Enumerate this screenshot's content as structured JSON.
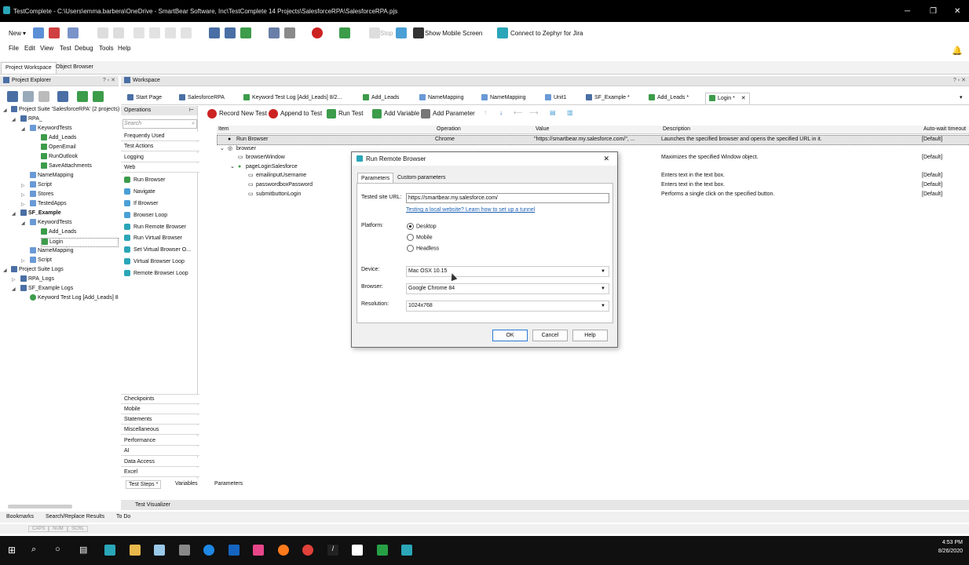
{
  "window": {
    "title": "TestComplete - C:\\Users\\emma.barbera\\OneDrive - SmartBear Software, Inc\\TestComplete 14 Projects\\SalesforceRPA\\SalesforceRPA.pjs"
  },
  "toolbar": {
    "new_label": "New",
    "stop_label": "Stop",
    "show_mobile_label": "Show Mobile Screen",
    "zephyr_label": "Connect to  Zephyr for Jira"
  },
  "menu": [
    "File",
    "Edit",
    "View",
    "Test",
    "Debug",
    "Tools",
    "Help"
  ],
  "top_tabs": [
    "Project Workspace",
    "Object Browser"
  ],
  "panels": {
    "project_explorer": "Project Explorer",
    "workspace": "Workspace",
    "operations": "Operations"
  },
  "tree": [
    "Project Suite 'SalesforceRPA' (2 projects)",
    "RPA_",
    "KeywordTests",
    "Add_Leads",
    "OpenEmail",
    "RunOutlook",
    "SaveAttachments",
    "NameMapping",
    "Script",
    "Stores",
    "TestedApps",
    "SF_Example",
    "KeywordTests",
    "Add_Leads",
    "Login",
    "NameMapping",
    "Script",
    "Project Suite Logs",
    "RPA_Logs",
    "SF_Example Logs",
    "Keyword Test Log [Add_Leads] 8"
  ],
  "ops": {
    "search_placeholder": "Search",
    "top_categories": [
      "Frequently Used",
      "Test Actions",
      "Logging",
      "Web"
    ],
    "web_items": [
      "Run Browser",
      "Navigate",
      "If Browser",
      "Browser Loop",
      "Run Remote Browser",
      "Run Virtual Browser",
      "Set Virtual Browser O...",
      "Virtual Browser Loop",
      "Remote Browser Loop"
    ],
    "bottom_categories": [
      "Checkpoints",
      "Mobile",
      "Statements",
      "Miscellaneous",
      "Performance",
      "AI",
      "Data Access",
      "Excel"
    ]
  },
  "ws_tabs": [
    "Start Page",
    "SalesforceRPA",
    "Keyword Test Log [Add_Leads] 8/2...",
    "Add_Leads",
    "NameMapping",
    "NameMapping",
    "Unit1",
    "SF_Example *",
    "Add_Leads *",
    "Login *"
  ],
  "kw_toolbar": [
    "Record New Test",
    "Append to Test",
    "Run Test",
    "Add Variable",
    "Add Parameter"
  ],
  "grid": {
    "headers": [
      "Item",
      "Operation",
      "Value",
      "Description",
      "Auto-wait timeout"
    ],
    "rows": [
      {
        "item": "Run Browser",
        "operation": "Chrome",
        "value": "\"https://smartbear.my.salesforce.com/\", ...",
        "description": "Launches the specified browser and opens the specified URL in it.",
        "timeout": "[Default]"
      },
      {
        "item": "browser",
        "operation": "",
        "value": "",
        "description": "",
        "timeout": ""
      },
      {
        "item": "browserWindow",
        "operation": "",
        "value": "",
        "description": "Maximizes the specified Window object.",
        "timeout": "[Default]"
      },
      {
        "item": "pageLoginSalesforce",
        "operation": "",
        "value": "",
        "description": "",
        "timeout": ""
      },
      {
        "item": "emailinputUsername",
        "operation": "",
        "value": "",
        "description": "Enters text in the text box.",
        "timeout": "[Default]"
      },
      {
        "item": "passwordboxPassword",
        "operation": "",
        "value": "",
        "description": "Enters text in the text box.",
        "timeout": "[Default]"
      },
      {
        "item": "submitbuttonLogin",
        "operation": "",
        "value": "",
        "description": "Performs a single click on the specified button.",
        "timeout": "[Default]"
      }
    ]
  },
  "bottom_tabs": [
    "Test Steps *",
    "Variables",
    "Parameters"
  ],
  "visualizer": "Test Visualizer",
  "status_tabs": [
    "Bookmarks",
    "Search/Replace Results",
    "To Do"
  ],
  "caps": [
    "CAPS",
    "NUM",
    "SCRL"
  ],
  "dialog": {
    "title": "Run Remote Browser",
    "tabs": [
      "Parameters",
      "Custom parameters"
    ],
    "url_label": "Tested site URL:",
    "url_value": "https://smartbear.my.salesforce.com/",
    "link_text": "Testing a local website? Learn how to set up a tunnel",
    "platform_label": "Platform:",
    "platforms": [
      "Desktop",
      "Mobile",
      "Headless"
    ],
    "selected_platform": "Desktop",
    "device_label": "Device:",
    "device_value": "Mac OSX 10.15",
    "browser_label": "Browser:",
    "browser_value": "Google Chrome 84",
    "resolution_label": "Resolution:",
    "resolution_value": "1024x768",
    "ok": "OK",
    "cancel": "Cancel",
    "help": "Help"
  },
  "clock": {
    "time": "4:53 PM",
    "date": "8/26/2020"
  },
  "colors": {
    "accent": "#2aa6b8",
    "titlebar": "#000000",
    "taskbar": "#101010"
  }
}
